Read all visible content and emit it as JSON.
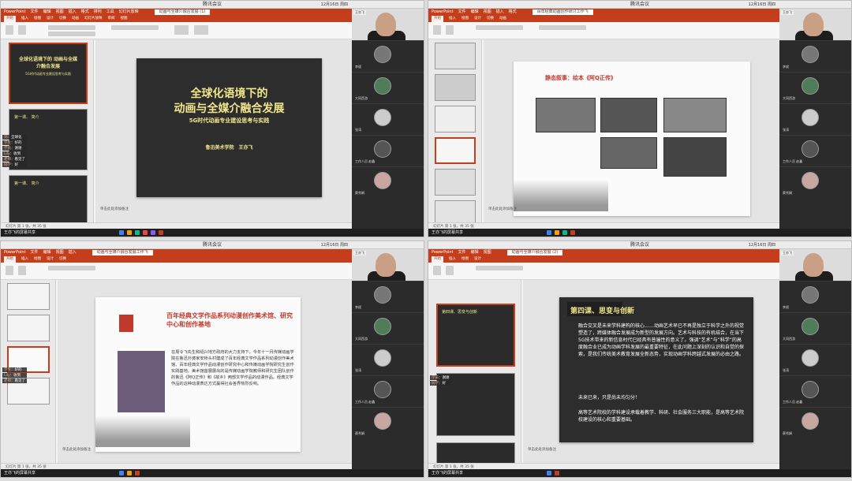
{
  "window_title": "腾讯会议",
  "clock": "12月16日 周四",
  "app_name": "PowerPoint",
  "menu": [
    "文件",
    "编辑",
    "视图",
    "插入",
    "格式",
    "排列",
    "工具",
    "幻灯片放映",
    "窗口",
    "帮助"
  ],
  "ribbon_tabs": [
    "开始",
    "插入",
    "绘图",
    "设计",
    "切换",
    "动画",
    "幻灯片放映",
    "审阅",
    "视图"
  ],
  "docs": [
    "动画与全媒介融合发展 (1)",
    "百年经典动画创作研讨工作飞",
    "动画与全媒介融合发展工作飞",
    "动画与全媒介融合发展 (2)"
  ],
  "notes_hint": "单击此处添加备注",
  "status_text": "幻灯片 第 1 张，共 35 张",
  "speaker": {
    "tag": "王亦飞",
    "name": "王亦飞"
  },
  "dock_label": "王亦飞的屏幕共享",
  "participants": [
    "王亦飞",
    "李斌",
    "工作人员",
    "大同西游",
    "张涛",
    "工作人员 赵鑫",
    "蔡秀娟"
  ],
  "chat": [
    {
      "name": "刘",
      "text": "全球化"
    },
    {
      "name": "学生",
      "text": "好的"
    },
    {
      "name": "学员",
      "text": "谢谢"
    },
    {
      "name": "Lily",
      "text": "收到"
    },
    {
      "name": "老师",
      "text": "看见了"
    },
    {
      "name": "同学",
      "text": "好"
    }
  ],
  "slide1": {
    "title_l1": "全球化语境下的",
    "title_l2": "动画与全媒介融合发展",
    "subtitle": "5G时代动画专业建设思考与实践",
    "author": "鲁迅美术学院　王亦飞",
    "thumb_title": "全球化语境下的 动画与全媒介融合发展",
    "thumb_sub": "5G时代动画专业建设思考与实践",
    "thumb2_head": "第一课、 简介",
    "thumb3_head": "第一课、 简介"
  },
  "slide2": {
    "title": "静态叙事：绘本《阿Q正传》"
  },
  "slide3": {
    "title": "百年经典文学作品系列动漫创作美术馆、研究中心和创作基地",
    "body": "在周令飞先生和绍兴地方政府的大力支持下，今年十一月传媒动画学院在鲁迅外婆家安桥头村建成了百年经典文学作品系列动漫创作美术馆、百年经典文学作品动漫创作研究中心和传媒动画学院研究生创作实践基地。美术馆首展展出的是传媒动画学院教师和研究生团队创作的鲁迅《阿Q正传》和《故乡》两部文学作品的动漫作品。经典文学作品的这种动漫表达方式赢得社会各界热烈反响。"
  },
  "slide4": {
    "title": "第四课、思变与创新",
    "p1": "融合交叉是未来学科建构的核心……动画艺术早已不再是独立于科学之外的视觉塑造了，跨媒体融合发展成为新型的发展方向。艺术与科技的有机结合，在当下5G技术带来的新信息时代已经具有普遍性的意义了。强调“艺术”与“科学”的高度融合业已成为动画学科发展的最重要特征，在此问题上深刻的认识和自觉的探索，是我们传统美术教育发展全新态势，实现动画学科跨越式发展的必由之路。",
    "p2": "未来已来，只是尚未均匀分！",
    "p3": "高等艺术院校的学科建设承载着教学、科研、社会服务三大职能，是高等艺术院校建设的核心和重要基础。",
    "thumb_head": "第四课、思变与创新"
  },
  "colors": {
    "ppt_red": "#c43e1c",
    "gold": "#f0e58a",
    "title_red": "#c0392b"
  }
}
